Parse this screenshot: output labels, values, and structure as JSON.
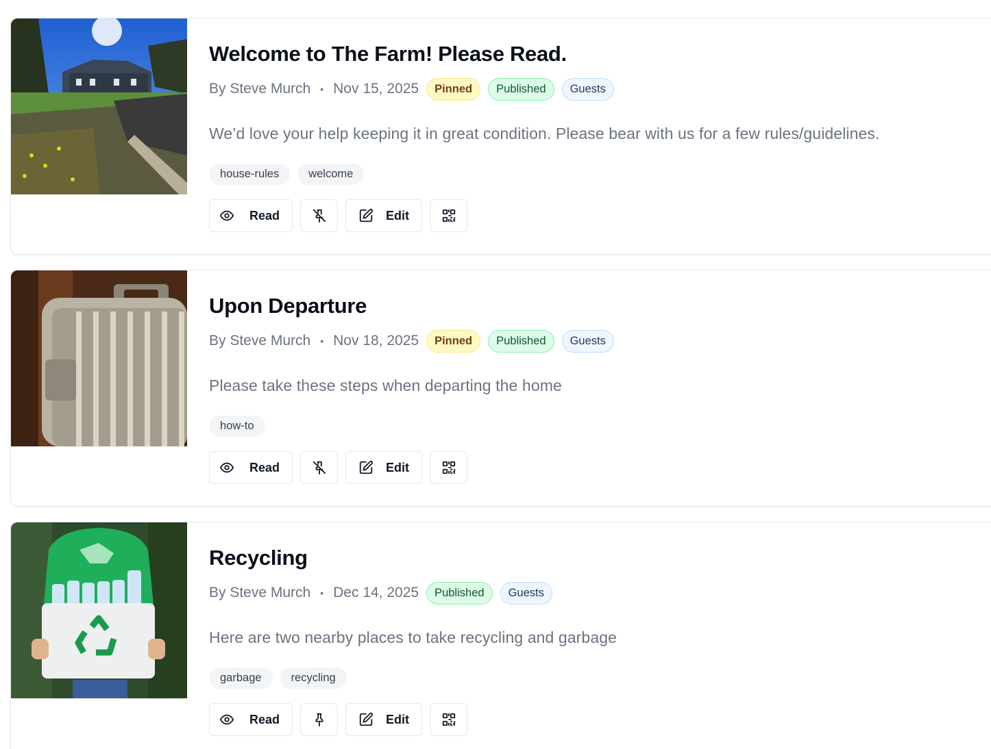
{
  "posts": [
    {
      "title": "Welcome to The Farm! Please Read.",
      "author": "By Steve Murch",
      "separator": "•",
      "date": "Nov 15, 2025",
      "badges": {
        "pinned": "Pinned",
        "published": "Published",
        "audience": "Guests"
      },
      "excerpt": "We’d love your help keeping it in great condition. Please bear with us for a few rules/guidelines.",
      "tags": [
        "house-rules",
        "welcome"
      ],
      "actions": {
        "read": "Read",
        "pin_icon": "unpin-icon",
        "edit": "Edit",
        "qr_icon": "qr-code-icon"
      }
    },
    {
      "title": "Upon Departure",
      "author": "By Steve Murch",
      "separator": "•",
      "date": "Nov 18, 2025",
      "badges": {
        "pinned": "Pinned",
        "published": "Published",
        "audience": "Guests"
      },
      "excerpt": "Please take these steps when departing the home",
      "tags": [
        "how-to"
      ],
      "actions": {
        "read": "Read",
        "pin_icon": "unpin-icon",
        "edit": "Edit",
        "qr_icon": "qr-code-icon"
      }
    },
    {
      "title": "Recycling",
      "author": "By Steve Murch",
      "separator": "•",
      "date": "Dec 14, 2025",
      "badges": {
        "published": "Published",
        "audience": "Guests"
      },
      "excerpt": "Here are two nearby places to take recycling and garbage",
      "tags": [
        "garbage",
        "recycling"
      ],
      "actions": {
        "read": "Read",
        "pin_icon": "pin-icon",
        "edit": "Edit",
        "qr_icon": "qr-code-icon"
      }
    }
  ],
  "colors": {
    "pinned_bg": "#fef9c3",
    "published_bg": "#dcfce7",
    "guests_bg": "#eff6ff",
    "muted_text": "#6b7280"
  }
}
